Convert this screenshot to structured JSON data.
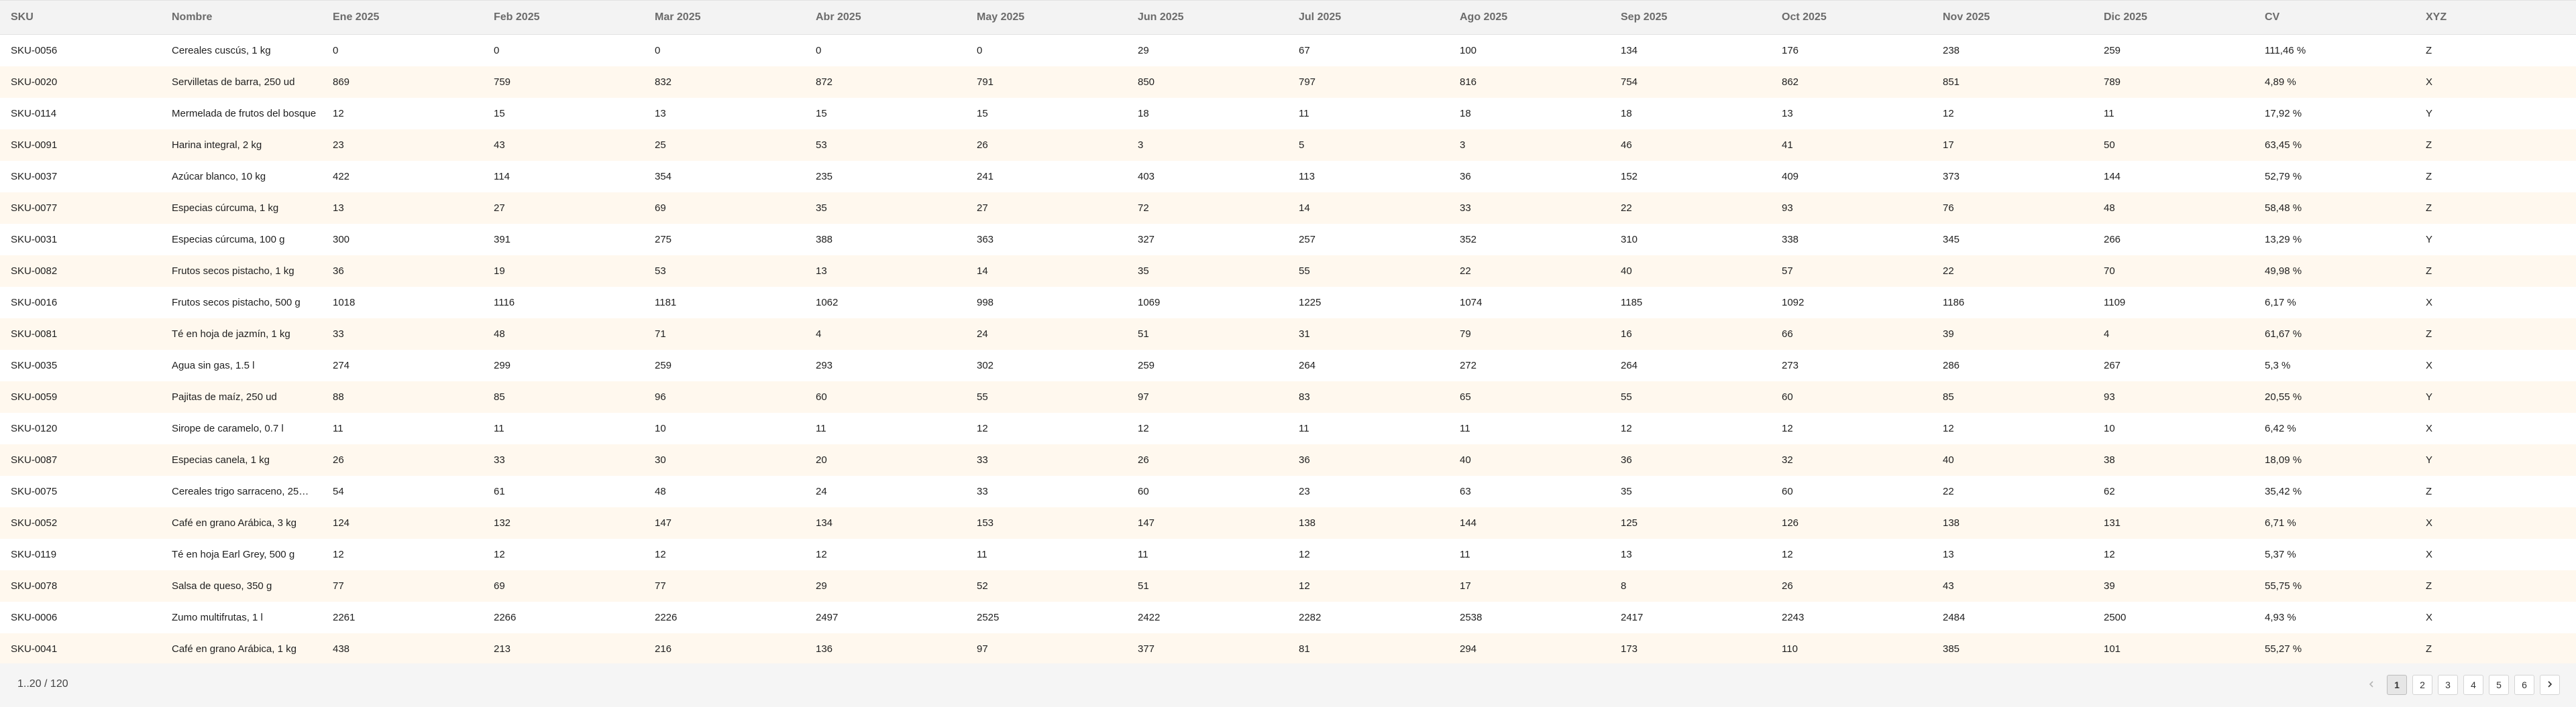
{
  "table": {
    "headers": [
      "SKU",
      "Nombre",
      "Ene 2025",
      "Feb 2025",
      "Mar 2025",
      "Abr 2025",
      "May 2025",
      "Jun 2025",
      "Jul 2025",
      "Ago 2025",
      "Sep 2025",
      "Oct 2025",
      "Nov 2025",
      "Dic 2025",
      "CV",
      "XYZ"
    ],
    "rows": [
      [
        "SKU-0056",
        "Cereales cuscús, 1 kg",
        "0",
        "0",
        "0",
        "0",
        "0",
        "29",
        "67",
        "100",
        "134",
        "176",
        "238",
        "259",
        "111,46 %",
        "Z"
      ],
      [
        "SKU-0020",
        "Servilletas de barra, 250 ud",
        "869",
        "759",
        "832",
        "872",
        "791",
        "850",
        "797",
        "816",
        "754",
        "862",
        "851",
        "789",
        "4,89 %",
        "X"
      ],
      [
        "SKU-0114",
        "Mermelada de frutos del bosque",
        "12",
        "15",
        "13",
        "15",
        "15",
        "18",
        "11",
        "18",
        "18",
        "13",
        "12",
        "11",
        "17,92 %",
        "Y"
      ],
      [
        "SKU-0091",
        "Harina integral, 2 kg",
        "23",
        "43",
        "25",
        "53",
        "26",
        "3",
        "5",
        "3",
        "46",
        "41",
        "17",
        "50",
        "63,45 %",
        "Z"
      ],
      [
        "SKU-0037",
        "Azúcar blanco, 10 kg",
        "422",
        "114",
        "354",
        "235",
        "241",
        "403",
        "113",
        "36",
        "152",
        "409",
        "373",
        "144",
        "52,79 %",
        "Z"
      ],
      [
        "SKU-0077",
        "Especias cúrcuma, 1 kg",
        "13",
        "27",
        "69",
        "35",
        "27",
        "72",
        "14",
        "33",
        "22",
        "93",
        "76",
        "48",
        "58,48 %",
        "Z"
      ],
      [
        "SKU-0031",
        "Especias cúrcuma, 100 g",
        "300",
        "391",
        "275",
        "388",
        "363",
        "327",
        "257",
        "352",
        "310",
        "338",
        "345",
        "266",
        "13,29 %",
        "Y"
      ],
      [
        "SKU-0082",
        "Frutos secos pistacho, 1 kg",
        "36",
        "19",
        "53",
        "13",
        "14",
        "35",
        "55",
        "22",
        "40",
        "57",
        "22",
        "70",
        "49,98 %",
        "Z"
      ],
      [
        "SKU-0016",
        "Frutos secos pistacho, 500 g",
        "1018",
        "1116",
        "1181",
        "1062",
        "998",
        "1069",
        "1225",
        "1074",
        "1185",
        "1092",
        "1186",
        "1109",
        "6,17 %",
        "X"
      ],
      [
        "SKU-0081",
        "Té en hoja de jazmín, 1 kg",
        "33",
        "48",
        "71",
        "4",
        "24",
        "51",
        "31",
        "79",
        "16",
        "66",
        "39",
        "4",
        "61,67 %",
        "Z"
      ],
      [
        "SKU-0035",
        "Agua sin gas, 1.5 l",
        "274",
        "299",
        "259",
        "293",
        "302",
        "259",
        "264",
        "272",
        "264",
        "273",
        "286",
        "267",
        "5,3 %",
        "X"
      ],
      [
        "SKU-0059",
        "Pajitas de maíz, 250 ud",
        "88",
        "85",
        "96",
        "60",
        "55",
        "97",
        "83",
        "65",
        "55",
        "60",
        "85",
        "93",
        "20,55 %",
        "Y"
      ],
      [
        "SKU-0120",
        "Sirope de caramelo, 0.7 l",
        "11",
        "11",
        "10",
        "11",
        "12",
        "12",
        "11",
        "11",
        "12",
        "12",
        "12",
        "10",
        "6,42 %",
        "X"
      ],
      [
        "SKU-0087",
        "Especias canela, 1 kg",
        "26",
        "33",
        "30",
        "20",
        "33",
        "26",
        "36",
        "40",
        "36",
        "32",
        "40",
        "38",
        "18,09 %",
        "Y"
      ],
      [
        "SKU-0075",
        "Cereales trigo sarraceno, 25…",
        "54",
        "61",
        "48",
        "24",
        "33",
        "60",
        "23",
        "63",
        "35",
        "60",
        "22",
        "62",
        "35,42 %",
        "Z"
      ],
      [
        "SKU-0052",
        "Café en grano Arábica, 3 kg",
        "124",
        "132",
        "147",
        "134",
        "153",
        "147",
        "138",
        "144",
        "125",
        "126",
        "138",
        "131",
        "6,71 %",
        "X"
      ],
      [
        "SKU-0119",
        "Té en hoja Earl Grey, 500 g",
        "12",
        "12",
        "12",
        "12",
        "11",
        "11",
        "12",
        "11",
        "13",
        "12",
        "13",
        "12",
        "5,37 %",
        "X"
      ],
      [
        "SKU-0078",
        "Salsa de queso, 350 g",
        "77",
        "69",
        "77",
        "29",
        "52",
        "51",
        "12",
        "17",
        "8",
        "26",
        "43",
        "39",
        "55,75 %",
        "Z"
      ],
      [
        "SKU-0006",
        "Zumo multifrutas, 1 l",
        "2261",
        "2266",
        "2226",
        "2497",
        "2525",
        "2422",
        "2282",
        "2538",
        "2417",
        "2243",
        "2484",
        "2500",
        "4,93 %",
        "X"
      ],
      [
        "SKU-0041",
        "Café en grano Arábica, 1 kg",
        "438",
        "213",
        "216",
        "136",
        "97",
        "377",
        "81",
        "294",
        "173",
        "110",
        "385",
        "101",
        "55,27 %",
        "Z"
      ]
    ]
  },
  "footer": {
    "range_label": "1..20 / 120",
    "pages": [
      "1",
      "2",
      "3",
      "4",
      "5",
      "6"
    ],
    "current_page": "1",
    "prev_icon": "chevron-left-icon",
    "next_icon": "chevron-right-icon"
  }
}
